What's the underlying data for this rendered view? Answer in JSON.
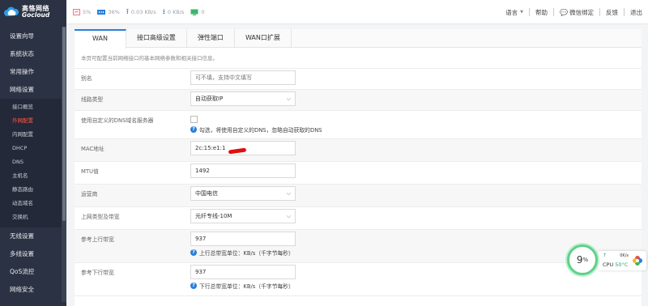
{
  "brand": {
    "name_cn": "高恪网络",
    "name_en": "Gocloud"
  },
  "sidebar": {
    "items_top": [
      "设置向导",
      "系统状态",
      "常用操作",
      "网络设置"
    ],
    "sub_items": [
      "接口概览",
      "外网配置",
      "内网配置",
      "DHCP",
      "DNS",
      "主机名",
      "静态路由",
      "动态域名",
      "交换机"
    ],
    "active_sub": "外网配置",
    "items_bottom": [
      "无线设置",
      "多线设置",
      "QoS流控",
      "网络安全"
    ]
  },
  "topbar": {
    "stats": [
      {
        "icon": "cpu-icon",
        "value": "5%"
      },
      {
        "icon": "memory-icon",
        "value": "36%"
      },
      {
        "icon": "upload-icon",
        "value": "0.03 KB/s"
      },
      {
        "icon": "download-icon",
        "value": "0 KB/s"
      },
      {
        "icon": "monitor-icon",
        "value": "0"
      }
    ],
    "language": "语言",
    "help": "帮助",
    "wechat": "微信绑定",
    "feedback": "反馈",
    "logout": "退出"
  },
  "tabs": [
    "WAN",
    "接口高级设置",
    "弹性端口",
    "WAN口扩展"
  ],
  "active_tab": "WAN",
  "intro": "本页可配置当前网络接口的基本网络参数和相关接口信息。",
  "form": {
    "alias": {
      "label": "别名",
      "placeholder": "可不填，支持中文填写"
    },
    "line_type": {
      "label": "线路类型",
      "value": "自动获取IP"
    },
    "custom_dns": {
      "label": "使用自定义的DNS域名服务器",
      "hint": "勾选，将使用自定义的DNS，忽略自动获取的DNS"
    },
    "mac": {
      "label": "MAC地址",
      "value": "2c:15:e1:1"
    },
    "mtu": {
      "label": "MTU值",
      "value": "1492"
    },
    "isp": {
      "label": "运营商",
      "value": "中国电信"
    },
    "uplink_type": {
      "label": "上网类型及带宽",
      "value": "光纤专线-10M"
    },
    "up_bw": {
      "label": "参考上行带宽",
      "value": "937",
      "hint": "上行总带宽单位：KB/s（千字节每秒）"
    },
    "down_bw": {
      "label": "参考下行带宽",
      "value": "937",
      "hint": "下行总带宽单位：KB/s（千字节每秒）"
    }
  },
  "cpu_widget": {
    "percent": "9",
    "unit": "%",
    "speed": "0K/s",
    "up_arrow": "↑",
    "cpu_label": "CPU",
    "temp": "50°C"
  },
  "colors": {
    "sidebar_bg": "#2b3243",
    "accent": "#2a7fdc",
    "active_red": "#ff5a4a",
    "ring_green": "#5fd08a"
  }
}
